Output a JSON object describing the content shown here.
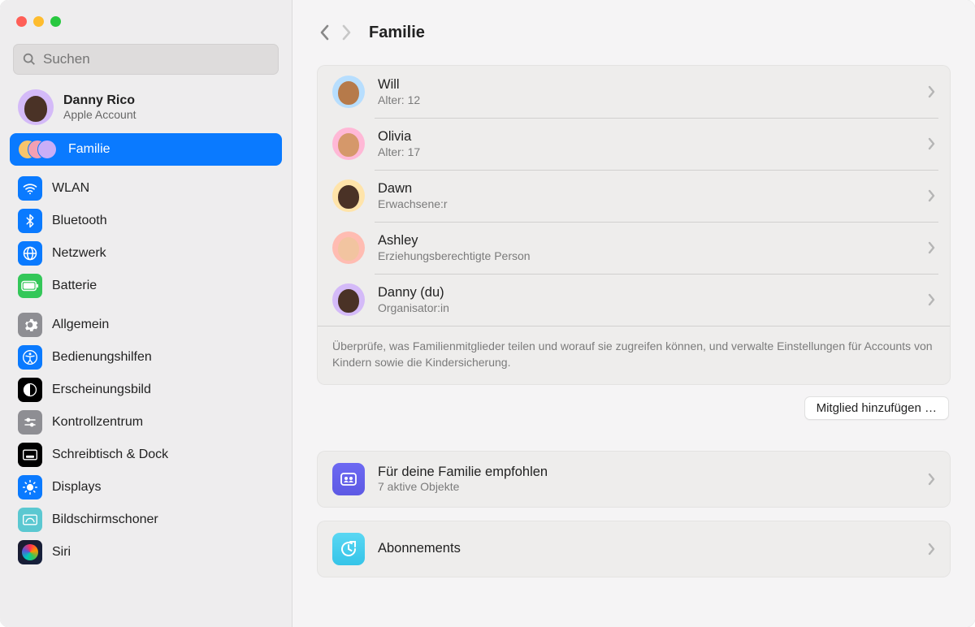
{
  "search": {
    "placeholder": "Suchen"
  },
  "account": {
    "name": "Danny Rico",
    "sub": "Apple Account"
  },
  "sidebar": {
    "family": "Familie",
    "items1": [
      {
        "label": "WLAN"
      },
      {
        "label": "Bluetooth"
      },
      {
        "label": "Netzwerk"
      },
      {
        "label": "Batterie"
      }
    ],
    "items2": [
      {
        "label": "Allgemein"
      },
      {
        "label": "Bedienungshilfen"
      },
      {
        "label": "Erscheinungsbild"
      },
      {
        "label": "Kontrollzentrum"
      },
      {
        "label": "Schreibtisch & Dock"
      },
      {
        "label": "Displays"
      },
      {
        "label": "Bildschirmschoner"
      },
      {
        "label": "Siri"
      }
    ]
  },
  "header": {
    "title": "Familie"
  },
  "members": [
    {
      "name": "Will",
      "sub": "Alter: 12"
    },
    {
      "name": "Olivia",
      "sub": "Alter: 17"
    },
    {
      "name": "Dawn",
      "sub": "Erwachsene:r"
    },
    {
      "name": "Ashley",
      "sub": "Erziehungsberechtigte Person"
    },
    {
      "name": "Danny (du)",
      "sub": "Organisator:in"
    }
  ],
  "members_footer": "Überprüfe, was Familienmitglieder teilen und worauf sie zugreifen können, und verwalte Einstellungen für Accounts von Kindern sowie die Kindersicherung.",
  "add_member": "Mitglied hinzufügen …",
  "recommended": {
    "title": "Für deine Familie empfohlen",
    "sub": "7 aktive Objekte"
  },
  "subscriptions": {
    "title": "Abonnements"
  }
}
